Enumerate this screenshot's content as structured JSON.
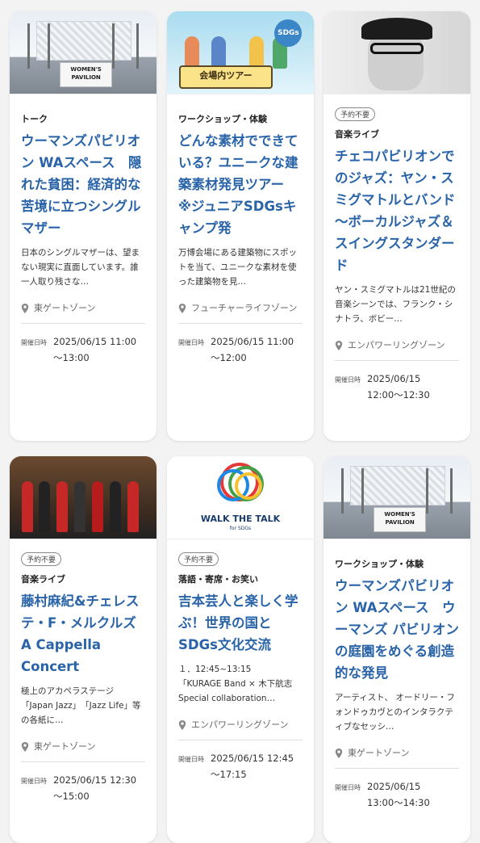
{
  "cards": [
    {
      "thumb": "womens-pavilion-photo",
      "thumb_sign": "WOMEN'S PAVILION",
      "badge": "",
      "category": "トーク",
      "title": "ウーマンズパビリオン WAスペース　隠れた貧困：経済的な苦境に立つシングルマザー",
      "description": "日本のシングルマザーは、望まない現実に直面しています。誰一人取り残さな…",
      "location": "東ゲートゾーン",
      "date_label": "開催日時",
      "date": "2025/06/15 11:00\n～13:00"
    },
    {
      "thumb": "junior-sdgs-camp-illustration",
      "thumb_banner": "会場内ツアー",
      "thumb_logo": "SDGs",
      "badge": "",
      "category": "ワークショップ・体験",
      "title": "どんな素材でできている？ユニークな建築素材発見ツアー　※ジュニアSDGsキャンプ発",
      "description": "万博会場にある建築物にスポットを当て、ユニークな素材を使った建築物を見…",
      "location": "フューチャーライフゾーン",
      "date_label": "開催日時",
      "date": "2025/06/15 11:00\n～12:00"
    },
    {
      "thumb": "artist-portrait-photo",
      "badge": "予約不要",
      "category": "音楽ライブ",
      "title": "チェコパビリオンでのジャズ：ヤン・スミグマトルとバンド～ボーカルジャズ＆スイングスタンダード",
      "description": "ヤン・スミグマトルは21世紀の音楽シーンでは、フランク・シナトラ、ボビー…",
      "location": "エンパワーリングゾーン",
      "date_label": "開催日時",
      "date": "2025/06/15\n12:00～12:30"
    },
    {
      "thumb": "acappella-stage-photo",
      "badge": "予約不要",
      "category": "音楽ライブ",
      "title": "藤村麻紀&チェレステ・F・メルクルズ A Cappella Concert",
      "description": "極上のアカペラステージ　　　　「Japan Jazz」　「Jazz Life」等の各紙に…",
      "location": "東ゲートゾーン",
      "date_label": "開催日時",
      "date": "2025/06/15 12:30\n～15:00"
    },
    {
      "thumb": "walk-the-talk-logo",
      "thumb_title": "WALK THE TALK",
      "thumb_sub": "for SDGs",
      "badge": "予約不要",
      "category": "落語・寄席・お笑い",
      "title": "吉本芸人と楽しく学ぶ！世界の国とSDGs文化交流",
      "description": "１．12:45~13:15\n「KURAGE Band × 木下航志 Special collaboration…",
      "location": "エンパワーリングゾーン",
      "date_label": "開催日時",
      "date": "2025/06/15 12:45\n～17:15"
    },
    {
      "thumb": "womens-pavilion-photo",
      "thumb_sign": "WOMEN'S PAVILION",
      "badge": "",
      "category": "ワークショップ・体験",
      "title": "ウーマンズパビリオン WAスペース　ウーマンズ パビリオンの庭園をめぐる創造的な発見",
      "description": "アーティスト、 オードリー・フォンドゥカヴとのインタラクティブなセッシ…",
      "location": "東ゲートゾーン",
      "date_label": "開催日時",
      "date": "2025/06/15\n13:00～14:30"
    }
  ],
  "colors": {
    "title": "#2a64a8",
    "background": "#f3f3f3"
  }
}
